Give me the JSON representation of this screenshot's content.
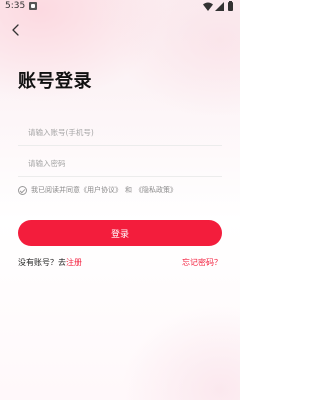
{
  "status_bar": {
    "time": "5:35"
  },
  "icons": {
    "notification": "notification-icon",
    "wifi": "wifi-icon",
    "signal": "signal-icon",
    "battery": "battery-icon",
    "back": "back-arrow-icon",
    "checkbox": "check-circle-icon"
  },
  "login": {
    "title": "账号登录",
    "phone_placeholder": "请输入账号(手机号)",
    "password_placeholder": "请输入密码",
    "phone_value": "",
    "password_value": "",
    "agreement": {
      "prefix": "我已阅读并同意",
      "user_agreement": "《用户协议》",
      "and": "和",
      "privacy_policy": "《隐私政策》",
      "checked": false
    },
    "login_button": "登录",
    "no_account": "没有账号？去",
    "register": "注册",
    "forgot_password": "忘记密码？"
  },
  "colors": {
    "accent": "#f31d3c",
    "title": "#111111",
    "placeholder": "#a5a5a5"
  }
}
